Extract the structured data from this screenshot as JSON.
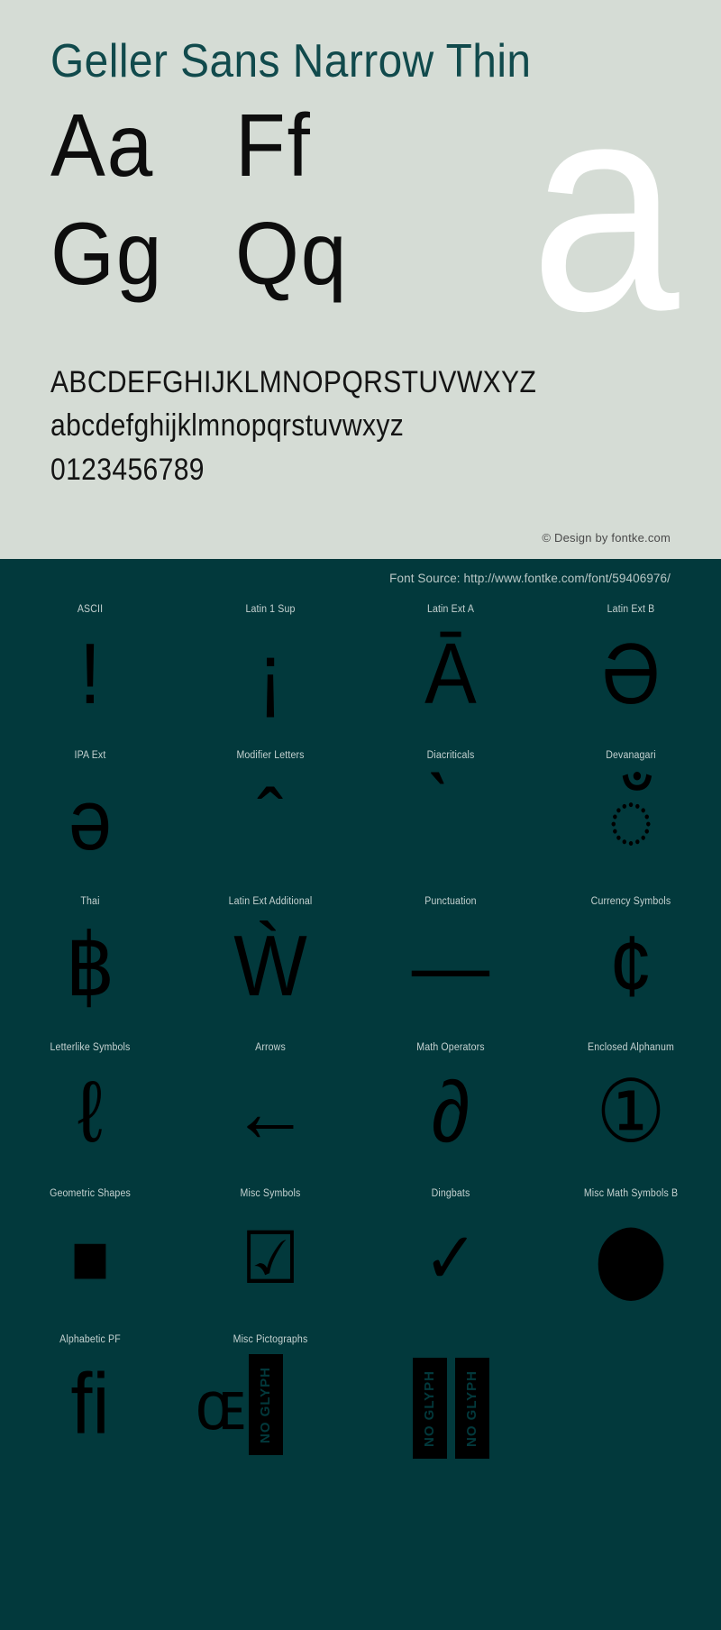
{
  "specimen": {
    "title": "Geller Sans Narrow Thin",
    "sample_pairs": [
      "Aa",
      "Ff",
      "Gg",
      "Qq"
    ],
    "giant_letter": "a",
    "alphabet_uppercase": "ABCDEFGHIJKLMNOPQRSTUVWXYZ",
    "alphabet_lowercase": "abcdefghijklmnopqrstuvwxyz",
    "digits": "0123456789",
    "credit": "© Design by fontke.com",
    "colors": {
      "background": "#d5dcd5",
      "title": "#114a4c",
      "glyph": "#0d0d0d",
      "giant": "#ffffff"
    }
  },
  "blocks_section": {
    "source_label": "Font Source: http://www.fontke.com/font/59406976/",
    "colors": {
      "background": "#02393c",
      "label": "#c5d2d1",
      "glyph": "#000000"
    },
    "rows": [
      {
        "labels": [
          "ASCII",
          "Latin 1 Sup",
          "Latin Ext A",
          "Latin Ext B"
        ],
        "glyphs": [
          "!",
          "¡",
          "Ā",
          "Ә"
        ]
      },
      {
        "labels": [
          "IPA Ext",
          "Modifier Letters",
          "Diacriticals",
          "Devanagari"
        ],
        "glyphs": [
          "ə",
          "ˆ",
          "̀",
          "ँ"
        ]
      },
      {
        "labels": [
          "Thai",
          "Latin Ext Additional",
          "Punctuation",
          "Currency Symbols"
        ],
        "glyphs": [
          "฿",
          "Ẁ",
          "—",
          "¢"
        ]
      },
      {
        "labels": [
          "Letterlike Symbols",
          "Arrows",
          "Math Operators",
          "Enclosed Alphanum"
        ],
        "glyphs": [
          "ℓ",
          "←",
          "∂",
          "①"
        ]
      },
      {
        "labels": [
          "Geometric Shapes",
          "Misc Symbols",
          "Dingbats",
          "Misc Math Symbols B"
        ],
        "glyphs": [
          "■",
          "☑",
          "✓",
          "⬤"
        ]
      },
      {
        "labels": [
          "Alphabetic PF",
          "Misc Pictographs",
          "",
          ""
        ],
        "glyphs": [
          "ﬁ",
          "ɶ",
          "",
          ""
        ]
      }
    ],
    "no_glyph_label": "NO GLYPH",
    "no_glyph_count": 3
  }
}
